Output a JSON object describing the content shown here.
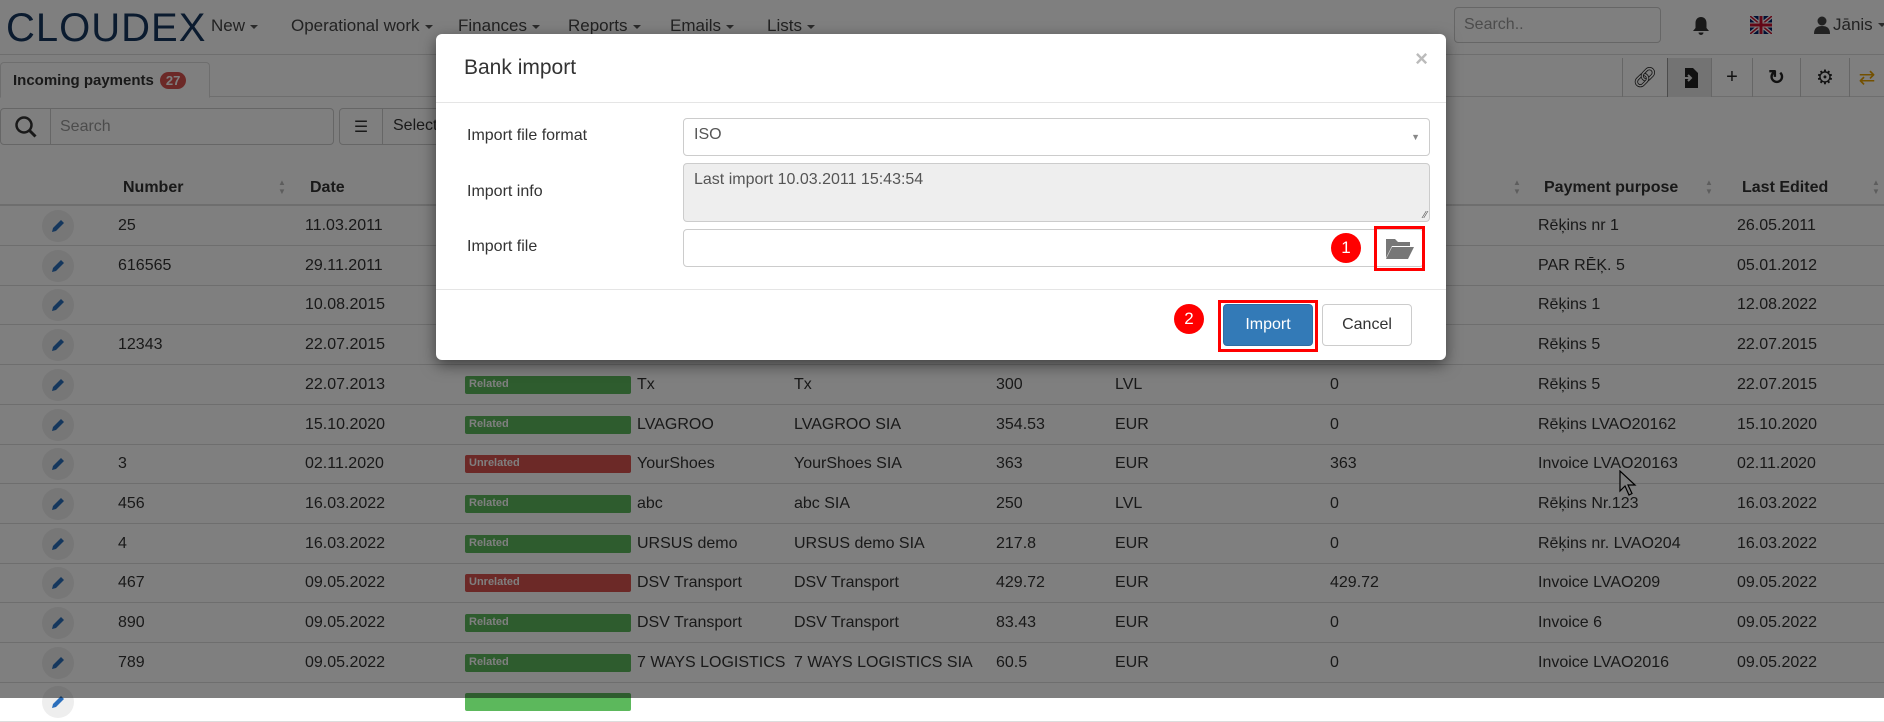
{
  "app": {
    "logo": "CLOUDEX"
  },
  "nav": {
    "items": [
      "New",
      "Operational work",
      "Finances",
      "Reports",
      "Emails",
      "Lists"
    ],
    "search_placeholder": "Search..",
    "user": "Jānis"
  },
  "tab": {
    "label": "Incoming payments",
    "count": "27"
  },
  "toolbar": {
    "icons": [
      "link-icon",
      "import-file-icon",
      "plus-icon",
      "refresh-icon",
      "gear-icon",
      "swap-icon"
    ],
    "accent": "#e6a100"
  },
  "filters": {
    "search_placeholder": "Search",
    "select_label": "Select"
  },
  "table": {
    "headers": {
      "number": "Number",
      "date": "Date",
      "purpose": "Payment purpose",
      "last_edited": "Last Edited"
    },
    "rows": [
      {
        "number": "25",
        "date": "11.03.2011",
        "purpose": "Rēķins nr 1",
        "last_edited": "26.05.2011"
      },
      {
        "number": "616565",
        "date": "29.11.2011",
        "purpose": "PAR RĒĶ. 5",
        "last_edited": "05.01.2012"
      },
      {
        "number": "",
        "date": "10.08.2015",
        "purpose": "Rēķins 1",
        "last_edited": "12.08.2022"
      },
      {
        "number": "12343",
        "date": "22.07.2015",
        "purpose": "Rēķins 5",
        "last_edited": "22.07.2015"
      },
      {
        "number": "",
        "date": "22.07.2013",
        "status": "Related",
        "partner": "Tx",
        "company": "Tx",
        "amount": "300",
        "currency": "LVL",
        "unpaid": "0",
        "purpose": "Rēķins 5",
        "last_edited": "22.07.2015"
      },
      {
        "number": "",
        "date": "15.10.2020",
        "status": "Related",
        "partner": "LVAGROO",
        "company": "LVAGROO SIA",
        "amount": "354.53",
        "currency": "EUR",
        "unpaid": "0",
        "purpose": "Rēķins LVAO20162",
        "last_edited": "15.10.2020"
      },
      {
        "number": "3",
        "date": "02.11.2020",
        "status": "Unrelated",
        "partner": "YourShoes",
        "company": "YourShoes SIA",
        "amount": "363",
        "currency": "EUR",
        "unpaid": "363",
        "purpose": "Invoice LVAO20163",
        "last_edited": "02.11.2020"
      },
      {
        "number": "456",
        "date": "16.03.2022",
        "status": "Related",
        "partner": "abc",
        "company": "abc SIA",
        "amount": "250",
        "currency": "LVL",
        "unpaid": "0",
        "purpose": "Rēķins Nr.123",
        "last_edited": "16.03.2022"
      },
      {
        "number": "4",
        "date": "16.03.2022",
        "status": "Related",
        "partner": "URSUS demo",
        "company": "URSUS demo SIA",
        "amount": "217.8",
        "currency": "EUR",
        "unpaid": "0",
        "purpose": "Rēķins nr. LVAO204",
        "last_edited": "16.03.2022"
      },
      {
        "number": "467",
        "date": "09.05.2022",
        "status": "Unrelated",
        "partner": "DSV Transport",
        "company": "DSV Transport",
        "amount": "429.72",
        "currency": "EUR",
        "unpaid": "429.72",
        "purpose": "Invoice LVAO209",
        "last_edited": "09.05.2022"
      },
      {
        "number": "890",
        "date": "09.05.2022",
        "status": "Related",
        "partner": "DSV Transport",
        "company": "DSV Transport",
        "amount": "83.43",
        "currency": "EUR",
        "unpaid": "0",
        "purpose": "Invoice 6",
        "last_edited": "09.05.2022"
      },
      {
        "number": "789",
        "date": "09.05.2022",
        "status": "Related",
        "partner": "7 WAYS LOGISTICS",
        "company": "7 WAYS LOGISTICS SIA",
        "amount": "60.5",
        "currency": "EUR",
        "unpaid": "0",
        "purpose": "Invoice LVAO2016",
        "last_edited": "09.05.2022"
      }
    ],
    "status_colors": {
      "Related": "#5cb85c",
      "Unrelated": "#d9534f"
    }
  },
  "modal": {
    "title": "Bank import",
    "close": "×",
    "format_label": "Import file format",
    "format_value": "ISO",
    "info_label": "Import info",
    "info_value": "Last import 10.03.2011 15:43:54",
    "file_label": "Import file",
    "file_value": "",
    "import_label": "Import",
    "cancel_label": "Cancel",
    "primary_color": "#337ab7",
    "step_markers": [
      "1",
      "2"
    ],
    "highlight_color": "#ff0000"
  }
}
